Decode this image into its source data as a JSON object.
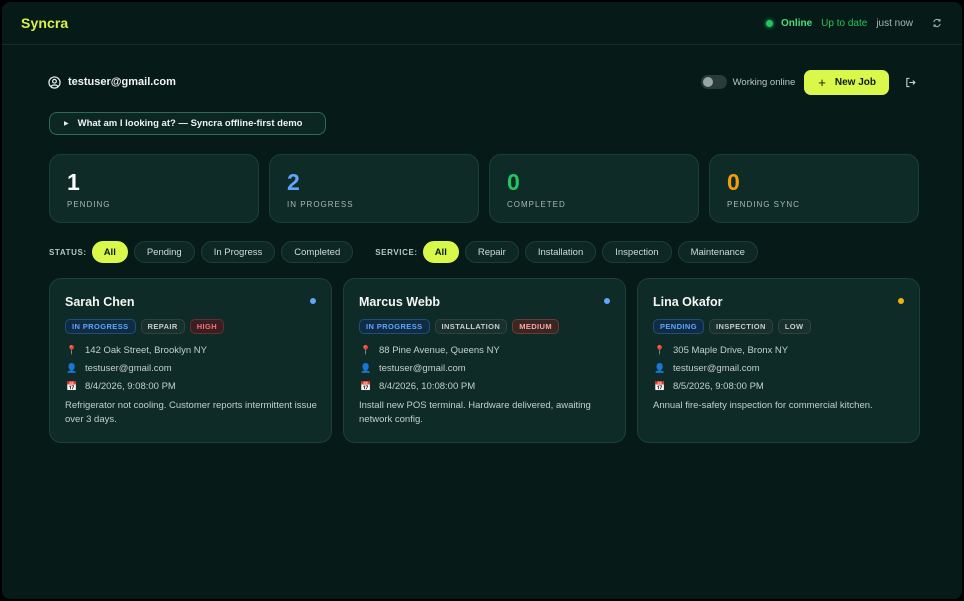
{
  "app": {
    "name": "Syncra"
  },
  "sync": {
    "online_label": "Online",
    "status": "Up to date",
    "last_sync": "just now"
  },
  "user": {
    "email": "testuser@gmail.com"
  },
  "controls": {
    "mode_label": "Working online",
    "new_job_label": "New Job"
  },
  "demo": {
    "label": "What am I looking at? — Syncra offline-first demo"
  },
  "stats": [
    {
      "value": "1",
      "label": "PENDING",
      "color": "#ffffff"
    },
    {
      "value": "2",
      "label": "IN PROGRESS",
      "color": "#60a5fa"
    },
    {
      "value": "0",
      "label": "COMPLETED",
      "color": "#22c55e"
    },
    {
      "value": "0",
      "label": "PENDING SYNC",
      "color": "#f59e0b"
    }
  ],
  "filters": {
    "status_label": "STATUS:",
    "status_options": [
      "All",
      "Pending",
      "In Progress",
      "Completed"
    ],
    "service_label": "SERVICE:",
    "service_options": [
      "All",
      "Repair",
      "Installation",
      "Inspection",
      "Maintenance"
    ]
  },
  "jobs": [
    {
      "customer": "Sarah Chen",
      "status": "IN PROGRESS",
      "service": "REPAIR",
      "priority": "HIGH",
      "address": "142 Oak Street, Brooklyn NY",
      "assignee": "testuser@gmail.com",
      "scheduled": "8/4/2026, 9:08:00 PM",
      "description": "Refrigerator not cooling. Customer reports intermittent issue over 3 days.",
      "dot_color": "#60a5fa"
    },
    {
      "customer": "Marcus Webb",
      "status": "IN PROGRESS",
      "service": "INSTALLATION",
      "priority": "MEDIUM",
      "address": "88 Pine Avenue, Queens NY",
      "assignee": "testuser@gmail.com",
      "scheduled": "8/4/2026, 10:08:00 PM",
      "description": "Install new POS terminal. Hardware delivered, awaiting network config.",
      "dot_color": "#60a5fa"
    },
    {
      "customer": "Lina Okafor",
      "status": "PENDING",
      "service": "INSPECTION",
      "priority": "LOW",
      "address": "305 Maple Drive, Bronx NY",
      "assignee": "testuser@gmail.com",
      "scheduled": "8/5/2026, 9:08:00 PM",
      "description": "Annual fire-safety inspection for commercial kitchen.",
      "dot_color": "#f5b014"
    }
  ],
  "icons": {
    "address": "pin-icon",
    "assignee": "person-icon",
    "scheduled": "calendar-icon"
  }
}
